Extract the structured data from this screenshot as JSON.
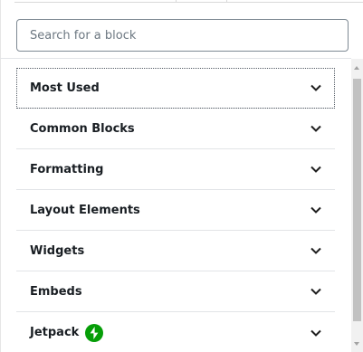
{
  "search": {
    "placeholder": "Search for a block"
  },
  "categories": [
    {
      "label": "Most Used",
      "icon": "chevron-down-icon",
      "focused": true
    },
    {
      "label": "Common Blocks",
      "icon": "chevron-down-icon"
    },
    {
      "label": "Formatting",
      "icon": "chevron-down-icon"
    },
    {
      "label": "Layout Elements",
      "icon": "chevron-down-icon"
    },
    {
      "label": "Widgets",
      "icon": "chevron-down-icon"
    },
    {
      "label": "Embeds",
      "icon": "chevron-down-icon"
    },
    {
      "label": "Jetpack",
      "icon": "chevron-down-icon",
      "badge_icon": "jetpack-logo-icon"
    }
  ],
  "colors": {
    "jetpack_green": "#069e08",
    "text": "#191e23",
    "border": "#e2e4e7"
  }
}
